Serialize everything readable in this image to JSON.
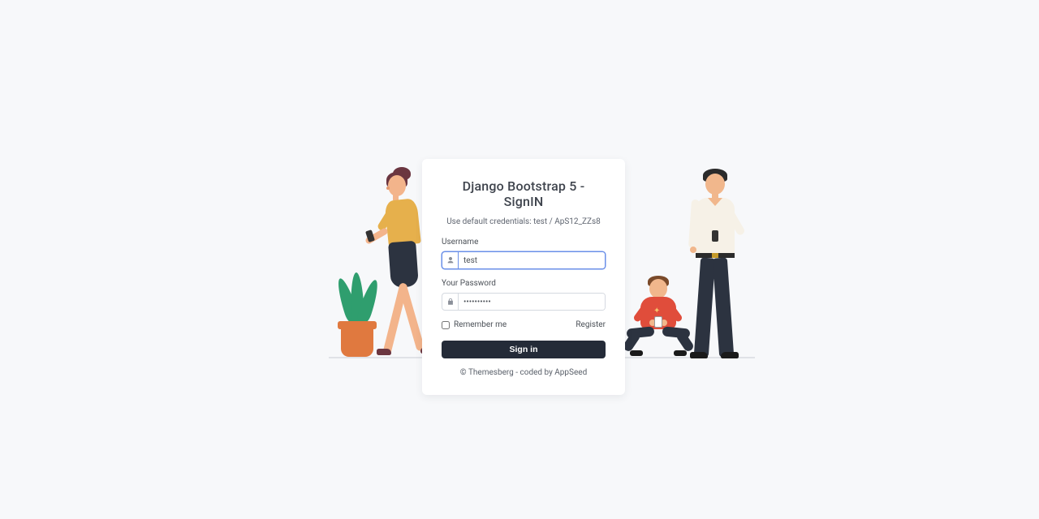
{
  "card": {
    "title": "Django Bootstrap 5 - SignIN",
    "subtitle": "Use default credentials: test / ApS12_ZZs8",
    "username": {
      "label": "Username",
      "value": "test",
      "placeholder": "Username"
    },
    "password": {
      "label": "Your Password",
      "value": "••••••••••",
      "placeholder": "Password"
    },
    "remember_label": "Remember me",
    "register_label": "Register",
    "submit_label": "Sign in"
  },
  "footer": {
    "copyright": "© ",
    "themesberg": "Themesberg",
    "middle": " - coded by ",
    "appseed": "AppSeed"
  },
  "icons": {
    "user": "user-icon",
    "lock": "lock-icon"
  },
  "colors": {
    "page_bg": "#f7f8fa",
    "card_bg": "#ffffff",
    "primary_btn": "#242b38",
    "focus_border": "#6a8fe8"
  }
}
